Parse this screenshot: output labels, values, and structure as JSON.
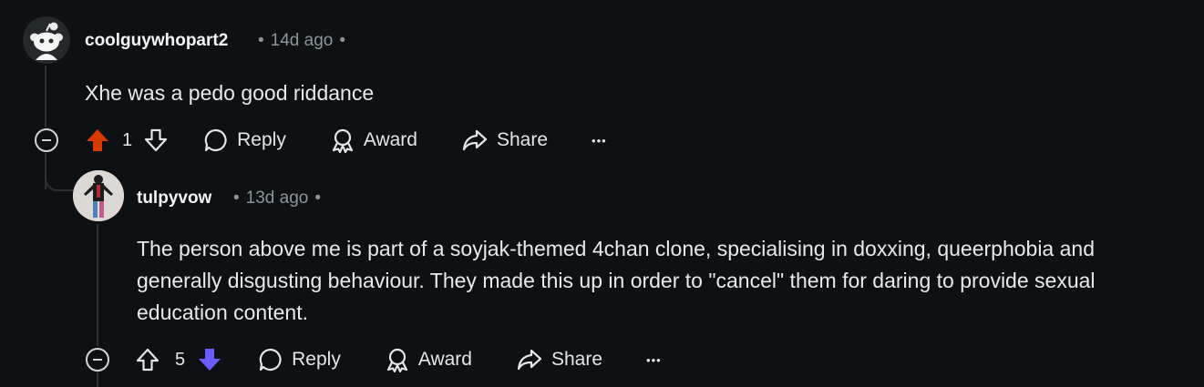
{
  "comments": [
    {
      "username": "coolguywhopart2",
      "age": "14d ago",
      "text": "Xhe was a pedo good riddance",
      "score": "1",
      "vote_state": "upvoted",
      "upvote_color": "#d93a00",
      "actions": {
        "reply": "Reply",
        "award": "Award",
        "share": "Share",
        "more": "•••"
      }
    },
    {
      "username": "tulpyvow",
      "age": "13d ago",
      "text": "The person above me is part of a soyjak-themed 4chan clone, specialising in doxxing, queerphobia and generally disgusting behaviour. They made this up in order to \"cancel\" them for daring to provide sexual education content.",
      "score": "5",
      "vote_state": "downvoted",
      "downvote_color": "#6a5cff",
      "actions": {
        "reply": "Reply",
        "award": "Award",
        "share": "Share",
        "more": "•••"
      }
    }
  ],
  "icons": {
    "avatar_1": "reddit-snoo-avatar",
    "avatar_2": "user-photo-avatar",
    "collapse": "collapse-minus-icon",
    "upvote": "arrow-up-icon",
    "downvote": "arrow-down-icon",
    "reply": "speech-bubble-icon",
    "award": "award-ribbon-icon",
    "share": "share-arrow-icon",
    "more": "ellipsis-icon"
  }
}
